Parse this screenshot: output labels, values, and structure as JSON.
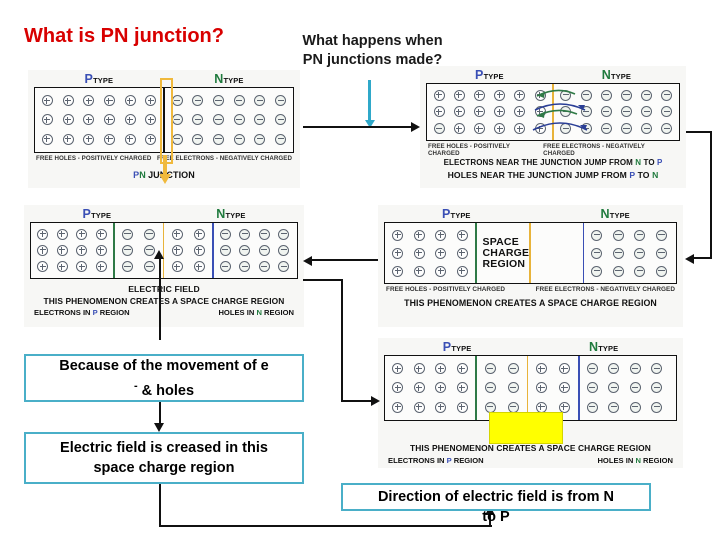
{
  "slide": {
    "title": "What is PN junction?",
    "subtitle": "What happens when\nPN junctions made?",
    "subtitle_line1": "What happens when",
    "subtitle_line2": "PN junctions made?",
    "title_color": "#d80000",
    "accent_color": "#4aafc8",
    "highlight_color": "#ffff00"
  },
  "labels": {
    "p_letter": "P",
    "p_word": "TYPE",
    "n_letter": "N",
    "n_word": "TYPE"
  },
  "diagram1": {
    "name": "pn-junction-formation",
    "p_label_letter": "P",
    "p_label_word": "TYPE",
    "n_label_letter": "N",
    "n_label_word": "TYPE",
    "caption_left": "Free Holes - Positively charged",
    "caption_right": "Free Electrons - Negatively charged",
    "footer_p": "P",
    "footer_n": "N",
    "footer_word": "JUNCTION",
    "p_rows": 3,
    "p_cols": 6,
    "n_rows": 3,
    "n_cols": 6
  },
  "diagram2": {
    "name": "carriers-jump-across-junction",
    "p_label_letter": "P",
    "p_label_word": "TYPE",
    "n_label_letter": "N",
    "n_label_word": "TYPE",
    "caption_left": "Free Holes - Positively charged",
    "caption_right": "Free Electrons - Negatively charged",
    "line1": "ELECTRONS NEAR THE JUNCTION  JUMP FROM N TO P",
    "line1_a": "ELECTRONS NEAR THE JUNCTION  JUMP FROM ",
    "line1_n": "N",
    "line1_b": " TO ",
    "line1_p": "P",
    "line2_a": "HOLES NEAR THE JUNCTION JUMP FROM ",
    "line2_p": "P",
    "line2_b": " TO ",
    "line2_n": "N",
    "p_rows": 3,
    "p_cols": 6,
    "n_rows": 3,
    "n_cols": 6
  },
  "diagram3": {
    "name": "space-charge-region",
    "p_label_letter": "P",
    "p_label_word": "TYPE",
    "n_label_letter": "N",
    "n_label_word": "TYPE",
    "region_line1": "SPACE CHARGE",
    "region_line2": "REGION",
    "caption_left": "Free Holes - Positively charged",
    "caption_right": "Free Electrons - Negatively charged",
    "footer": "THIS PHENOMENON CREATES A SPACE CHARGE REGION",
    "p_rows": 3,
    "p_cols": 4,
    "n_rows": 3,
    "n_cols": 4
  },
  "diagram4": {
    "name": "electric-field-in-space-charge-region",
    "p_label_letter": "P",
    "p_label_word": "TYPE",
    "n_label_letter": "N",
    "n_label_word": "TYPE",
    "field_label": "ELECTRIC FIELD",
    "footer": "THIS PHENOMENON CREATES A SPACE CHARGE REGION",
    "bottom_left_a": "ELECTRONS IN ",
    "bottom_left_p": "P",
    "bottom_left_b": " REGION",
    "bottom_right_a": "HOLES IN ",
    "bottom_right_n": "N",
    "bottom_right_b": " REGION",
    "p_rows": 3,
    "p_cols": 4,
    "n_rows": 3,
    "n_cols": 4
  },
  "diagram5": {
    "name": "space-charge-region-highlighted",
    "p_label_letter": "P",
    "p_label_word": "TYPE",
    "n_label_letter": "N",
    "n_label_word": "TYPE",
    "footer": "THIS PHENOMENON CREATES A SPACE CHARGE REGION",
    "bottom_left_a": "ELECTRONS IN ",
    "bottom_left_p": "P",
    "bottom_left_b": " REGION",
    "bottom_right_a": "HOLES IN ",
    "bottom_right_n": "N",
    "bottom_right_b": " REGION",
    "p_rows": 3,
    "p_cols": 4,
    "n_rows": 3,
    "n_cols": 4
  },
  "callouts": [
    {
      "name": "callout-movement",
      "line1": "Because of the movement of e",
      "superscript": "-",
      "line2": "& holes"
    },
    {
      "name": "callout-electric-field",
      "line1": "Electric field is creased in this",
      "line2": "space charge region"
    },
    {
      "name": "callout-field-direction",
      "line1": "Direction of electric field is from N",
      "line2": "to P"
    }
  ]
}
